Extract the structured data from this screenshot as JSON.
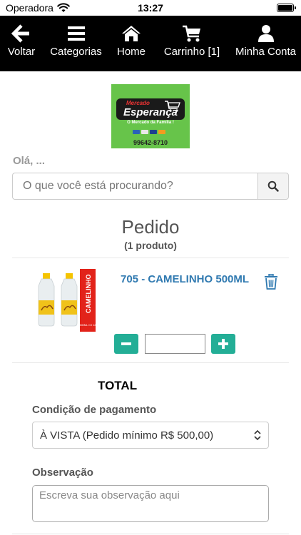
{
  "status_bar": {
    "carrier": "Operadora",
    "time": "13:27"
  },
  "nav": [
    {
      "label": "Voltar",
      "icon": "arrow-left-icon"
    },
    {
      "label": "Categorias",
      "icon": "menu-icon"
    },
    {
      "label": "Home",
      "icon": "home-icon"
    },
    {
      "label": "Carrinho [1]",
      "icon": "cart-icon"
    },
    {
      "label": "Minha Conta",
      "icon": "user-icon"
    }
  ],
  "logo": {
    "top_text": "Mercado",
    "name": "Esperança",
    "tagline": "O Mercado da Família !",
    "phone": "99642-8710"
  },
  "greeting": "Olá, ...",
  "search": {
    "placeholder": "O que você está procurando?"
  },
  "order": {
    "title": "Pedido",
    "count": "(1 produto)",
    "items": [
      {
        "name": "705 - CAMELINHO 500ML",
        "image_label": "CAMELINHO",
        "image_sub": "500ML CX 12",
        "quantity": ""
      }
    ]
  },
  "summary": {
    "total_label": "TOTAL",
    "payment_label": "Condição de pagamento",
    "payment_value": "À VISTA (Pedido mínimo R$ 500,00)",
    "notes_label": "Observação",
    "notes_placeholder": "Escreva sua observação aqui"
  },
  "colors": {
    "nav_bg": "#000000",
    "accent": "#23ae96",
    "link": "#2f79b0",
    "logo_bg": "#67c44a"
  }
}
